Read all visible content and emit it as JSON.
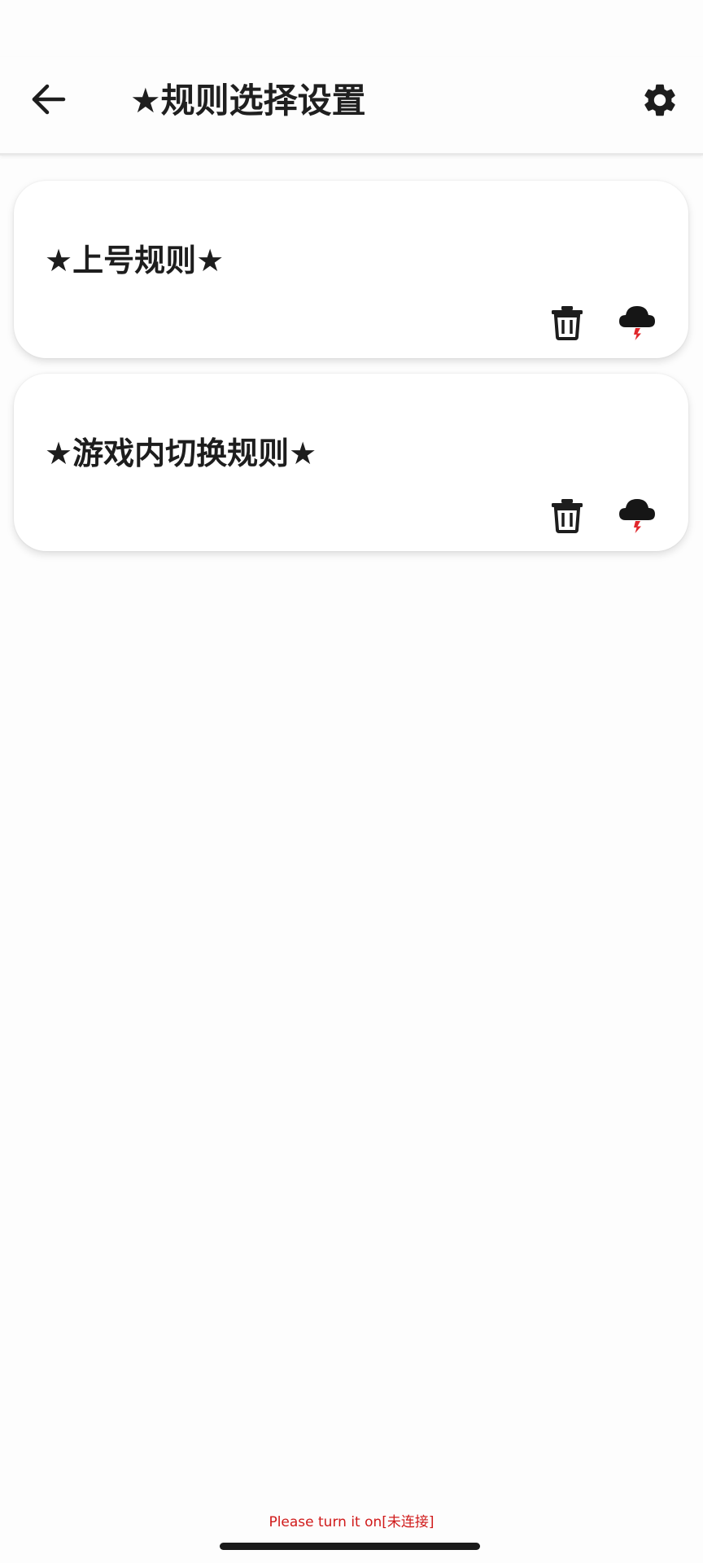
{
  "header": {
    "title": "★规则选择设置",
    "back_icon": "arrow-left-icon",
    "settings_icon": "gear-icon"
  },
  "rules": [
    {
      "name": "★上号规则★",
      "delete_icon": "trash-icon",
      "cloud_icon": "cloud-lightning-icon"
    },
    {
      "name": "★游戏内切换规则★",
      "delete_icon": "trash-icon",
      "cloud_icon": "cloud-lightning-icon"
    }
  ],
  "footer": {
    "status": "Please turn it on[未连接]"
  },
  "colors": {
    "text": "#1d1d1d",
    "status_red": "#d01a1a",
    "bolt_red": "#e0262b",
    "card_bg": "#ffffff",
    "page_bg": "#fdfdfd"
  }
}
